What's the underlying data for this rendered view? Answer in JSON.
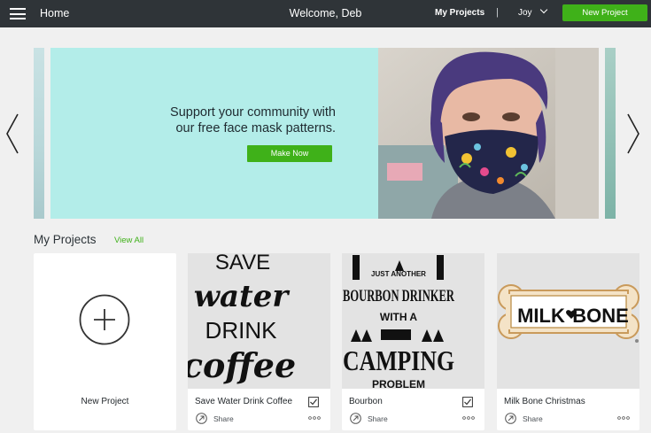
{
  "header": {
    "home": "Home",
    "welcome": "Welcome, Deb",
    "my_projects": "My Projects",
    "separator": "|",
    "user": "Joy",
    "new_project": "New Project"
  },
  "banner": {
    "headline_line1": "Support your community with",
    "headline_line2": "our free face mask patterns.",
    "button": "Make Now"
  },
  "section": {
    "title": "My Projects",
    "view_all": "View All"
  },
  "cards": {
    "new_project_label": "New Project",
    "share_label": "Share",
    "items": [
      {
        "title": "Save Water Drink Coffee",
        "art": [
          "SAVE",
          "water",
          "DRINK",
          "coffee"
        ]
      },
      {
        "title": "Bourbon",
        "art": [
          "JUST ANOTHER",
          "BOURBON DRINKER",
          "WITH A",
          "CAMPING",
          "PROBLEM"
        ]
      },
      {
        "title": "Milk Bone Christmas",
        "art": [
          "MILK",
          "BONE"
        ]
      }
    ]
  },
  "colors": {
    "topbar": "#2f3438",
    "accent_green": "#3fb119",
    "banner_bg": "#b3ede9",
    "page_bg": "#f0f0f0"
  }
}
